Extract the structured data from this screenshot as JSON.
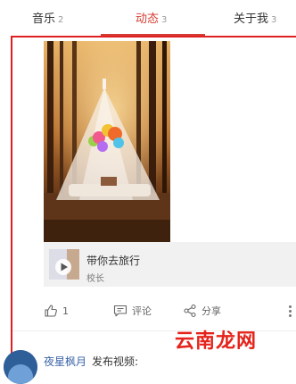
{
  "tabs": [
    {
      "label": "音乐",
      "count": "2",
      "active": false
    },
    {
      "label": "动态",
      "count": "3",
      "active": true
    },
    {
      "label": "关于我",
      "count": "3",
      "active": false
    }
  ],
  "accent_color": "#d43c33",
  "highlight_color": "#e02020",
  "post": {
    "shared_song": {
      "title": "带你去旅行",
      "artist": "校长",
      "cover_icon": "play-icon"
    },
    "actions": {
      "like_count": "1",
      "comment_label": "评论",
      "share_label": "分享",
      "like_icon": "thumbs-up-icon",
      "comment_icon": "comment-icon",
      "share_icon": "share-icon",
      "more_icon": "more-vertical-icon"
    }
  },
  "next_post": {
    "username": "夜星枫月",
    "action": "发布视频:"
  },
  "watermark": "云南龙网"
}
